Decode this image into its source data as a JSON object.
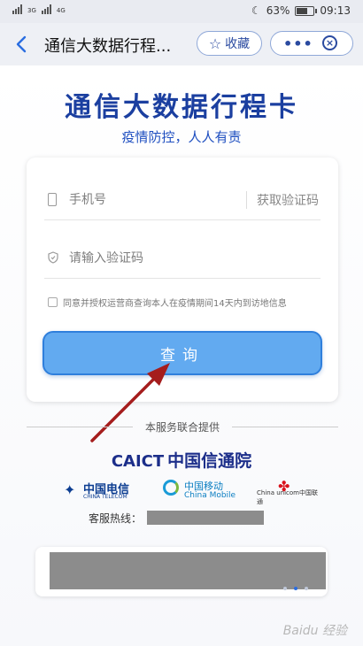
{
  "status_bar": {
    "signal_1": "3G",
    "signal_2": "4G",
    "battery": "63%",
    "time": "09:13"
  },
  "nav": {
    "title": "通信大数据行程...",
    "favorite_label": "收藏",
    "more_icon": "more-icon",
    "close_icon": "close-icon"
  },
  "hero": {
    "title": "通信大数据行程卡",
    "subtitle": "疫情防控，人人有责"
  },
  "form": {
    "phone_placeholder": "手机号",
    "get_code_label": "获取验证码",
    "code_placeholder": "请输入验证码",
    "agreement_text": "同意并授权运营商查询本人在疫情期间14天内到访地信息",
    "query_button": "查询"
  },
  "footer": {
    "provider_text": "本服务联合提供",
    "caict_en": "CAICT",
    "caict_cn": "中国信通院",
    "telecom_cn": "中国电信",
    "telecom_en": "CHINA TELECOM",
    "mobile_cn": "中国移动",
    "mobile_en": "China Mobile",
    "unicom_en": "China unicom中国联通",
    "hotline_label": "客服热线："
  },
  "watermark": "Baidu 经验",
  "colors": {
    "brand_blue": "#1b3fa0",
    "button_blue": "#62aaf0",
    "annotation_red": "#a51d1d"
  }
}
